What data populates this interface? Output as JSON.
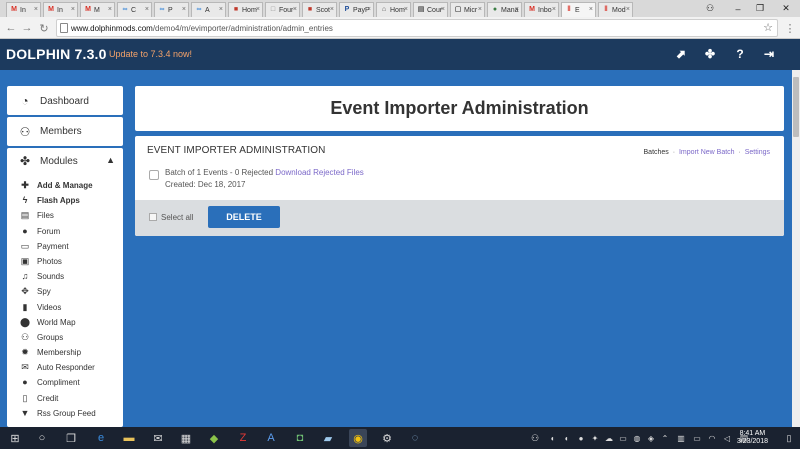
{
  "browser": {
    "tabs": [
      {
        "label": "In",
        "icon": "gmail-icon",
        "color": "#d93025",
        "glyph": "M"
      },
      {
        "label": "In",
        "icon": "gmail-icon",
        "color": "#d93025",
        "glyph": "M"
      },
      {
        "label": "M",
        "icon": "gmail-icon",
        "color": "#d93025",
        "glyph": "M"
      },
      {
        "label": "C",
        "icon": "infinity-icon",
        "color": "#4a90d9",
        "glyph": "∞"
      },
      {
        "label": "P",
        "icon": "infinity-icon",
        "color": "#4a90d9",
        "glyph": "∞"
      },
      {
        "label": "A",
        "icon": "infinity-icon",
        "color": "#4a90d9",
        "glyph": "∞"
      },
      {
        "label": "Hom",
        "icon": "site-icon",
        "color": "#c0392b",
        "glyph": "■"
      },
      {
        "label": "Four",
        "icon": "blank-page-icon",
        "color": "#888888",
        "glyph": "□"
      },
      {
        "label": "Scot",
        "icon": "scot-icon",
        "color": "#c0392b",
        "glyph": "■"
      },
      {
        "label": "PayP",
        "icon": "paypal-icon",
        "color": "#1f4e99",
        "glyph": "P"
      },
      {
        "label": "Hom",
        "icon": "home-icon",
        "color": "#555555",
        "glyph": "⌂"
      },
      {
        "label": "Cour",
        "icon": "document-icon",
        "color": "#555555",
        "glyph": "▤"
      },
      {
        "label": "Micr",
        "icon": "document-icon",
        "color": "#555555",
        "glyph": "▢"
      },
      {
        "label": "Mana",
        "icon": "manage-icon",
        "color": "#3a7d44",
        "glyph": "●"
      },
      {
        "label": "Inbo",
        "icon": "gmail-icon",
        "color": "#d93025",
        "glyph": "M"
      },
      {
        "label": "E",
        "icon": "pause-icon",
        "color": "#d93025",
        "glyph": "‖",
        "active": true
      },
      {
        "label": "Mod",
        "icon": "pause-icon",
        "color": "#d93025",
        "glyph": "‖"
      }
    ],
    "url_host": "www.dolphinmods.com",
    "url_path": "/demo4/m/evimporter/administration/admin_entries"
  },
  "header": {
    "brand": "DOLPHIN 7.3.0",
    "update_text": "Update to 7.3.4 now!"
  },
  "sidebar": {
    "dashboard": "Dashboard",
    "members": "Members",
    "modules": "Modules",
    "module_items": [
      {
        "label": "Add & Manage",
        "icon": "plus-icon",
        "glyph": "✚",
        "bold": true
      },
      {
        "label": "Flash Apps",
        "icon": "bolt-icon",
        "glyph": "ϟ",
        "bold": true
      },
      {
        "label": "Files",
        "icon": "files-icon",
        "glyph": "▤",
        "bold": false
      },
      {
        "label": "Forum",
        "icon": "comments-icon",
        "glyph": "●",
        "bold": false
      },
      {
        "label": "Payment",
        "icon": "credit-card-icon",
        "glyph": "▭",
        "bold": false
      },
      {
        "label": "Photos",
        "icon": "picture-icon",
        "glyph": "▣",
        "bold": false
      },
      {
        "label": "Sounds",
        "icon": "music-icon",
        "glyph": "♫",
        "bold": false
      },
      {
        "label": "Spy",
        "icon": "crosshair-icon",
        "glyph": "✥",
        "bold": false
      },
      {
        "label": "Videos",
        "icon": "film-icon",
        "glyph": "▮",
        "bold": false
      },
      {
        "label": "World Map",
        "icon": "map-marker-icon",
        "glyph": "⬤",
        "bold": false
      },
      {
        "label": "Groups",
        "icon": "users-icon",
        "glyph": "⚇",
        "bold": false
      },
      {
        "label": "Membership",
        "icon": "certificate-icon",
        "glyph": "✹",
        "bold": false
      },
      {
        "label": "Auto Responder",
        "icon": "envelope-icon",
        "glyph": "✉",
        "bold": false
      },
      {
        "label": "Compliment",
        "icon": "user-icon",
        "glyph": "●",
        "bold": false
      },
      {
        "label": "Credit",
        "icon": "document-icon",
        "glyph": "▯",
        "bold": false
      },
      {
        "label": "Rss Group Feed",
        "icon": "filter-icon",
        "glyph": "▼",
        "bold": false
      }
    ]
  },
  "main": {
    "page_title": "Event Importer Administration",
    "panel_title": "EVENT IMPORTER ADMINISTRATION",
    "links": {
      "batches": "Batches",
      "import": "Import New Batch",
      "settings": "Settings",
      "sep": "·"
    },
    "batch_text": "Batch of 1 Events - 0 Rejected",
    "download_link": "Download Rejected Files",
    "created": "Created: Dec 18, 2017",
    "select_all": "Select all",
    "delete": "DELETE"
  },
  "taskbar": {
    "time": "8:41 AM",
    "date": "3/23/2018"
  },
  "colors": {
    "page_bg": "#2a6fba",
    "header_bg": "#1c3a5e",
    "update_text": "#f5a36a",
    "link": "#7b68c8",
    "button": "#2a6fba"
  }
}
